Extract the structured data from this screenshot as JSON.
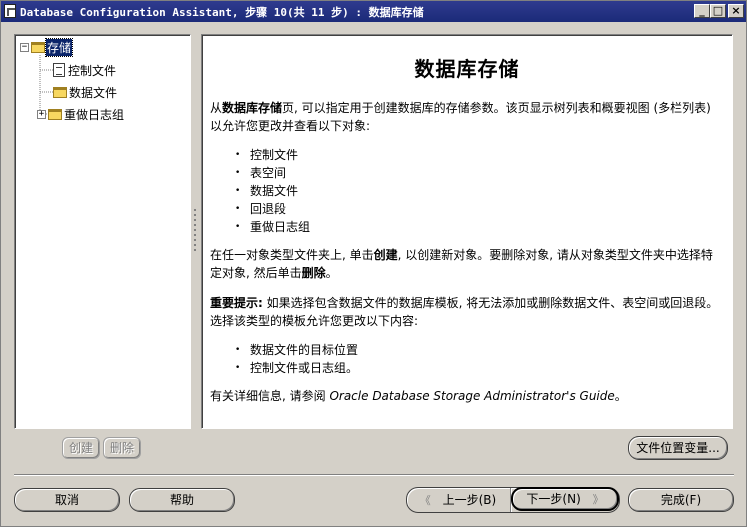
{
  "window": {
    "title": "Database Configuration Assistant, 步骤 10(共 11 步) : 数据库存储"
  },
  "tree": {
    "root_label": "存储",
    "items": [
      {
        "label": "控制文件",
        "icon": "document-icon"
      },
      {
        "label": "数据文件",
        "icon": "folder-icon"
      },
      {
        "label": "重做日志组",
        "icon": "folder-icon"
      }
    ]
  },
  "content": {
    "title": "数据库存储",
    "intro_pre": "从",
    "intro_bold": "数据库存储",
    "intro_post": "页, 可以指定用于创建数据库的存储参数。该页显示树列表和概要视图 (多栏列表) 以允许您更改并查看以下对象:",
    "objects": [
      "控制文件",
      "表空间",
      "数据文件",
      "回退段",
      "重做日志组"
    ],
    "create_pre": "在任一对象类型文件夹上, 单击",
    "create_bold": "创建",
    "create_mid": ", 以创建新对象。要删除对象, 请从对象类型文件夹中选择特定对象, 然后单击",
    "delete_bold": "删除",
    "create_end": "。",
    "important_bold": "重要提示:",
    "important_text": " 如果选择包含数据文件的数据库模板, 将无法添加或删除数据文件、表空间或回退段。选择该类型的模板允许您更改以下内容:",
    "changeable": [
      "数据文件的目标位置",
      "控制文件或日志组。"
    ],
    "more_info_pre": "有关详细信息, 请参阅 ",
    "more_info_italic": "Oracle Database Storage Administrator's Guide",
    "more_info_post": "。"
  },
  "buttons": {
    "create": "创建",
    "delete": "删除",
    "file_location_vars": "文件位置变量...",
    "cancel": "取消",
    "help": "帮助",
    "back": "上一步(B)",
    "next": "下一步(N)",
    "finish": "完成(F)"
  }
}
